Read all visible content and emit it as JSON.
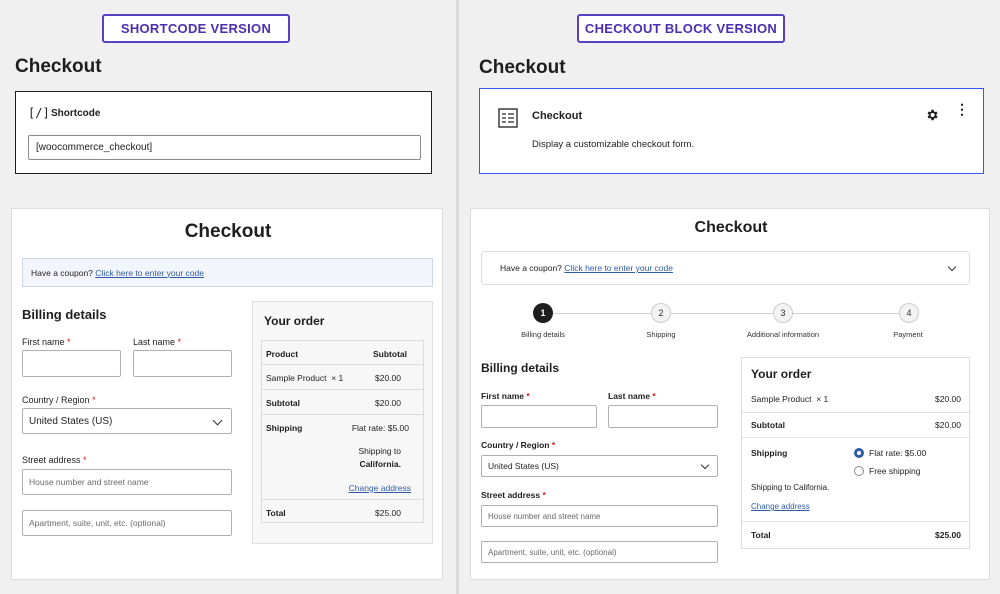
{
  "left": {
    "tag": "SHORTCODE VERSION",
    "editor_title": "Checkout",
    "shortcode_icon": "[/]",
    "shortcode_label": "Shortcode",
    "shortcode_value": "[woocommerce_checkout]",
    "preview": {
      "title": "Checkout",
      "coupon_text": "Have a coupon?",
      "coupon_link": "Click here to enter your code",
      "billing_title": "Billing details",
      "first_name": "First name",
      "last_name": "Last name",
      "country_label": "Country / Region",
      "country_value": "United States (US)",
      "street_label": "Street address",
      "street_placeholder": "House number and street name",
      "apt_placeholder": "Apartment, suite, unit, etc. (optional)",
      "required": "*",
      "order": {
        "title": "Your order",
        "col_product": "Product",
        "col_subtotal": "Subtotal",
        "item_name": "Sample Product",
        "item_qty": "× 1",
        "item_price": "$20.00",
        "subtotal_label": "Subtotal",
        "subtotal_value": "$20.00",
        "shipping_label": "Shipping",
        "shipping_rate": "Flat rate: $5.00",
        "shipping_to": "Shipping to",
        "shipping_dest": "California.",
        "change_address": "Change address",
        "total_label": "Total",
        "total_value": "$25.00"
      }
    }
  },
  "right": {
    "tag": "CHECKOUT BLOCK VERSION",
    "editor_title": "Checkout",
    "block_title": "Checkout",
    "block_desc": "Display a customizable checkout form.",
    "preview": {
      "title": "Checkout",
      "coupon_text": "Have a coupon?",
      "coupon_link": "Click here to enter your code",
      "steps": [
        {
          "num": "1",
          "label": "Billing details"
        },
        {
          "num": "2",
          "label": "Shipping"
        },
        {
          "num": "3",
          "label": "Additional information"
        },
        {
          "num": "4",
          "label": "Payment"
        }
      ],
      "billing_title": "Billing details",
      "first_name": "First name",
      "last_name": "Last name",
      "country_label": "Country / Region",
      "country_value": "United States (US)",
      "street_label": "Street address",
      "street_placeholder": "House number and street name",
      "apt_placeholder": "Apartment, suite, unit, etc. (optional)",
      "required": "*",
      "order": {
        "title": "Your order",
        "item_name": "Sample Product",
        "item_qty": "× 1",
        "item_price": "$20.00",
        "subtotal_label": "Subtotal",
        "subtotal_value": "$20.00",
        "shipping_label": "Shipping",
        "option_flat": "Flat rate: $5.00",
        "option_free": "Free shipping",
        "shipping_to": "Shipping to California.",
        "change_address": "Change address",
        "total_label": "Total",
        "total_value": "$25.00"
      }
    }
  },
  "colors": {
    "accent": "#5a3fc0",
    "link": "#2f5ba8",
    "block_border": "#3858e9",
    "required": "#cc1818"
  }
}
